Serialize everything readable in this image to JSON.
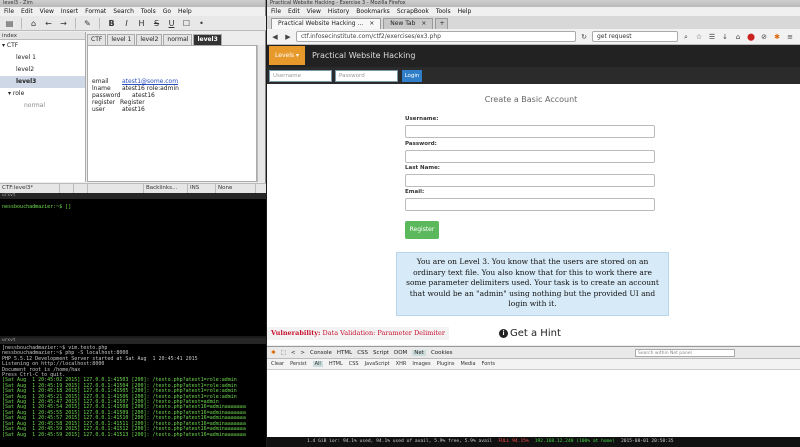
{
  "zim": {
    "title": "level3 - Zim",
    "menu": [
      "File",
      "Edit",
      "View",
      "Insert",
      "Format",
      "Search",
      "Tools",
      "Go",
      "Help"
    ],
    "index_header": "index",
    "index_items": [
      "CTF",
      "level 1",
      "level2",
      "level3",
      "role",
      "normal"
    ],
    "tabs": [
      "CTF",
      "level 1",
      "level2",
      "normal",
      "level3"
    ],
    "page": {
      "email_label": "email",
      "email_value": "atest1@some.com",
      "lname_label": "lname",
      "lname_value": "atest16 role:admin",
      "password_label": "password",
      "password_value": "atest16",
      "register_label": "register",
      "register_value": "Register",
      "user_label": "user",
      "user_value": "atest16"
    },
    "status": [
      "CTF:level3*",
      "",
      "",
      "",
      "Backlinks...",
      "INS",
      "None"
    ]
  },
  "term1": {
    "title": "urxvt",
    "prompt": "nessbouchadmazier:~$ ",
    "cursor": "[]"
  },
  "term2": {
    "title": "urxvt",
    "lines": [
      "[nessbouchadmazier:~$ vim.testo.php",
      "nessbouchadmazier:~$ php -S localhost:8000",
      "PHP 5.5.12 Development Server started at Sat Aug  1 20:45:41 2015",
      "Listening on http://localhost:8000",
      "Document root is /home/hax",
      "Press Ctrl-C to quit.",
      "[Sat Aug  1 20:45:02 2015] 127.0.0.1:41503 [200]: /testo.php?atest1=role:admin",
      "[Sat Aug  1 20:45:19 2015] 127.0.0.1:41504 [200]: /testo.php?atest1=role:admin",
      "[Sat Aug  1 20:45:18 2015] 127.0.0.1:41505 [200]: /testo.php?atest1=role:admin",
      "[Sat Aug  1 20:45:21 2015] 127.0.0.1:41506 [200]: /testo.php?atest1=role:admin",
      "[Sat Aug  1 20:45:47 2015] 127.0.0.1:41507 [200]: /testo.php?atest=admin",
      "[Sat Aug  1 20:45:54 2015] 127.0.0.1:41508 [200]: /testo.php?atest16=adminaaaaaaa",
      "[Sat Aug  1 20:45:55 2015] 127.0.0.1:41509 [200]: /testo.php?atest16=adminaaaaaaa",
      "[Sat Aug  1 20:45:57 2015] 127.0.0.1:41510 [200]: /testo.php?atest16=adminaaaaaaa",
      "[Sat Aug  1 20:45:58 2015] 127.0.0.1:41511 [200]: /testo.php?atest16=adminaaaaaaa",
      "[Sat Aug  1 20:45:59 2015] 127.0.0.1:41512 [200]: /testo.php?atest16=adminaaaaaaa",
      "[Sat Aug  1 20:45:59 2015] 127.0.0.1:41513 [200]: /testo.php?atest16=adminaaaaaaa"
    ]
  },
  "firefox": {
    "title": "Practical Website Hacking - Exercise 3 - Mozilla Firefox",
    "menu": [
      "File",
      "Edit",
      "View",
      "History",
      "Bookmarks",
      "ScrapBook",
      "Tools",
      "Help"
    ],
    "tabs": [
      "Practical Website Hacking ...",
      "New Tab"
    ],
    "url": "ctf.infosecinstitute.com/ctf2/exercises/ex3.php",
    "search_value": "get request",
    "site": {
      "levels_label": "Levels",
      "title": "Practical Website Hacking",
      "login_user_placeholder": "Username",
      "login_pass_placeholder": "Password",
      "login_button": "Login",
      "form_title": "Create a Basic Account",
      "labels": [
        "Username:",
        "Password:",
        "Last Name:",
        "Email:"
      ],
      "register_button": "Register",
      "info_text": "You are on Level 3. You know that the users are stored on an ordinary text file. You also know that for this to work there are some parameter delimiters used. Your task is to create an account that would be an \"admin\" using nothing but the provided UI and login with it.",
      "vuln_label": "Vulnerability:",
      "vuln_value": "Data Validation: Parameter Delimiter",
      "hint": "Get a Hint"
    },
    "firebug": {
      "tabs": [
        "Console",
        "HTML",
        "CSS",
        "Script",
        "DOM",
        "Net",
        "Cookies"
      ],
      "subtabs": [
        "Clear",
        "Persist",
        "All",
        "HTML",
        "CSS",
        "JavaScript",
        "XHR",
        "Images",
        "Plugins",
        "Media",
        "Fonts"
      ],
      "search_placeholder": "Search within Net panel"
    }
  },
  "statusbar": {
    "items": [
      "1.4 GiB ior: 94.1% used, 94.1% used of avail, 5.9% free, 5.9% avail",
      "FULL 94.15%",
      "192.168.12.248 (100% at home)",
      "2015-08-01 20:50:35"
    ]
  }
}
